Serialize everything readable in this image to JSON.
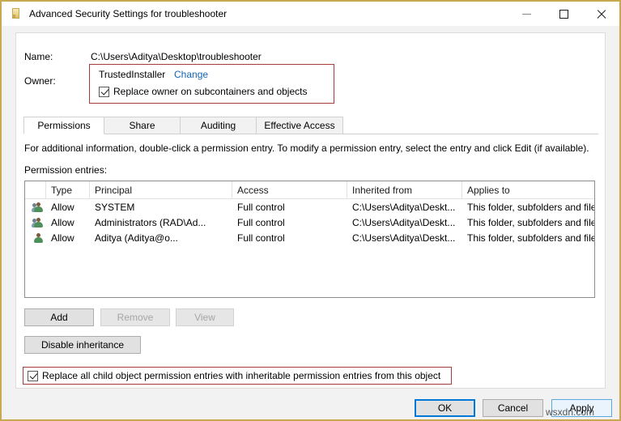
{
  "window": {
    "title": "Advanced Security Settings for troubleshooter",
    "icon": "folder-icon",
    "accent_color": "#c8a951",
    "caption": {
      "minimize": "minimize-icon",
      "maximize": "maximize-icon",
      "close": "close-icon"
    }
  },
  "header": {
    "name_label": "Name:",
    "name_value": "C:\\Users\\Aditya\\Desktop\\troubleshooter",
    "owner_label": "Owner:",
    "owner_value": "TrustedInstaller",
    "owner_change_link": "Change",
    "replace_owner_checkbox": {
      "label": "Replace owner on subcontainers and objects",
      "checked": true
    },
    "highlight_color": "#a83b3b"
  },
  "tabs": [
    {
      "label": "Permissions",
      "active": true
    },
    {
      "label": "Share",
      "active": false
    },
    {
      "label": "Auditing",
      "active": false
    },
    {
      "label": "Effective Access",
      "active": false
    }
  ],
  "main": {
    "info_text": "For additional information, double-click a permission entry. To modify a permission entry, select the entry and click Edit (if available).",
    "entries_label": "Permission entries:",
    "columns": [
      "Type",
      "Principal",
      "Access",
      "Inherited from",
      "Applies to"
    ],
    "rows": [
      {
        "icon": "group-icon",
        "type": "Allow",
        "principal": "SYSTEM",
        "access": "Full control",
        "inherited_from": "C:\\Users\\Aditya\\Deskt...",
        "applies_to": "This folder, subfolders and files"
      },
      {
        "icon": "group-icon",
        "type": "Allow",
        "principal": "Administrators (RAD\\Ad...",
        "access": "Full control",
        "inherited_from": "C:\\Users\\Aditya\\Deskt...",
        "applies_to": "This folder, subfolders and files"
      },
      {
        "icon": "user-icon",
        "type": "Allow",
        "principal": "Aditya (Aditya@o...",
        "access": "Full control",
        "inherited_from": "C:\\Users\\Aditya\\Deskt...",
        "applies_to": "This folder, subfolders and files"
      }
    ]
  },
  "actions": {
    "add": {
      "label": "Add",
      "enabled": true
    },
    "remove": {
      "label": "Remove",
      "enabled": false
    },
    "view": {
      "label": "View",
      "enabled": false
    },
    "disable_inheritance": {
      "label": "Disable inheritance",
      "enabled": true
    },
    "replace_all_checkbox": {
      "label": "Replace all child object permission entries with inheritable permission entries from this object",
      "checked": true
    }
  },
  "footer": {
    "ok": "OK",
    "cancel": "Cancel",
    "apply": "Apply"
  },
  "watermark": "wsxdn.com"
}
